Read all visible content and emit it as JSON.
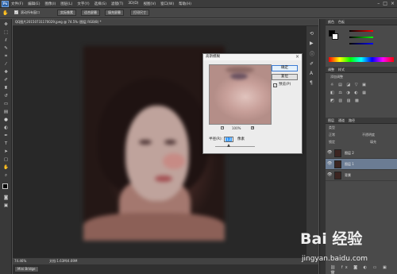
{
  "app": {
    "logo": "Ps"
  },
  "menubar": {
    "items": [
      "文件(F)",
      "编辑(E)",
      "图像(I)",
      "图层(L)",
      "文字(Y)",
      "选择(S)",
      "滤镜(T)",
      "3D(D)",
      "视图(V)",
      "窗口(W)",
      "帮助(H)"
    ],
    "controls": [
      "–",
      "□",
      "×"
    ]
  },
  "options_bar": {
    "scroll_all_label": "滚动所有窗口",
    "actual_pixels_label": "实际像素",
    "fit_screen_label": "适合屏幕",
    "fill_screen_label": "填充屏幕",
    "print_size_label": "打印尺寸"
  },
  "document": {
    "tab_title": "QQ图片20150731170029.jpeg @ 74.5% (图层 RGB/8) *",
    "zoom": "74.46%",
    "doc_info": "文档:1.63M/4.69M"
  },
  "bottom_bar": {
    "bridge_label": "Mini Bridge"
  },
  "panels": {
    "color_tabs": [
      "颜色",
      "色板"
    ],
    "adjust_tabs": [
      "调整",
      "样式"
    ],
    "adjust_add_label": "添加调整",
    "layers_tabs": [
      "图层",
      "通道",
      "路径"
    ],
    "kind_label": "类型",
    "blend_mode": "正常",
    "opacity_label": "不透明度",
    "lock_label": "锁定",
    "fill_label": "填充",
    "layers": [
      {
        "name": "图层 2",
        "selected": false
      },
      {
        "name": "图层 1",
        "selected": true
      },
      {
        "name": "背景",
        "selected": false
      }
    ]
  },
  "dialog": {
    "title": "高斯模糊",
    "ok_label": "确定",
    "reset_label": "复位",
    "preview_label": "预览(P)",
    "zoom_value": "100%",
    "radius_label": "半径(R):",
    "radius_value": "1.2",
    "radius_unit": "像素"
  },
  "watermark": {
    "brand": "Bai 经验",
    "url": "jingyan.baidu.com"
  }
}
